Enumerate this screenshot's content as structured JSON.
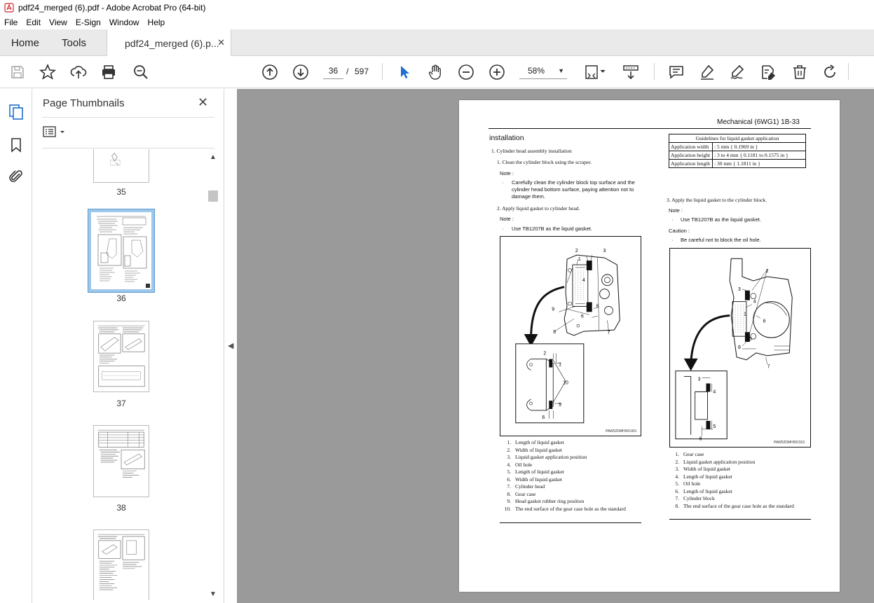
{
  "window": {
    "title": "pdf24_merged (6).pdf - Adobe Acrobat Pro (64-bit)"
  },
  "menu": [
    "File",
    "Edit",
    "View",
    "E-Sign",
    "Window",
    "Help"
  ],
  "tabs": {
    "home": "Home",
    "tools": "Tools",
    "document": "pdf24_merged (6).p...",
    "close": "✕"
  },
  "toolbar": {
    "current_page": "36",
    "page_separator": "/",
    "total_pages": "597",
    "zoom": "58%",
    "icons": [
      "save-icon",
      "bookmark-star-icon",
      "upload-icon",
      "print-icon",
      "find-zoom-icon",
      "page-up-icon",
      "page-down-icon",
      "select-cursor-icon",
      "hand-icon",
      "zoom-out-icon",
      "zoom-in-icon",
      "fit-page-icon",
      "scroll-mode-icon",
      "comment-icon",
      "highlight-icon",
      "sign-icon",
      "redact-icon",
      "delete-icon",
      "rotate-icon"
    ]
  },
  "panel": {
    "title": "Page Thumbnails",
    "close": "✕"
  },
  "thumbnails": [
    {
      "label": "35"
    },
    {
      "label": "36",
      "selected": true
    },
    {
      "label": "37"
    },
    {
      "label": "38"
    },
    {
      "label": ""
    }
  ],
  "page": {
    "header": "Mechanical (6WG1)   1B-33",
    "heading": "installation",
    "left": {
      "step1": "1.    Cylinder head assembly  installation",
      "step1_1": "1.    Clean the cylinder block using the scraper.",
      "note_label": "Note :",
      "note1_bullet": "·",
      "note1_text": "Carefully clean the cylinder block top surface and the cylinder head bottom surface, paying attention not to damage them.",
      "step1_2": "2.    Apply liquid gasket to cylinder head.",
      "note2_label": "Note :",
      "note2_text": "Use TB1207B as the liquid gasket.",
      "figure_code": "PAW52DMH001401",
      "figure_callouts": [
        "1",
        "2",
        "3",
        "4",
        "5",
        "6",
        "7",
        "8",
        "9",
        "10"
      ],
      "captions": [
        "Length of liquid gasket",
        "Width of liquid gasket",
        "Liquid gasket application position",
        "Oil hole",
        "Length of liquid gasket",
        "Width of liquid gasket",
        "Cylinder head",
        "Gear case",
        "Head gasket rubber ring position",
        "The end surface of the gear case hole as the standard"
      ]
    },
    "right": {
      "table_title": "Guidelines for liquid gasket application",
      "table_rows": [
        {
          "label": "Application width",
          "value": ":  5 mm { 0.1969 in }"
        },
        {
          "label": "Application height",
          "value": ":  3 to 4 mm { 0.1181 to 0.1575 in }"
        },
        {
          "label": "Application length",
          "value": ":  30 mm { 1.1811 in }"
        }
      ],
      "step3": "3.    Apply the liquid gasket to the cylinder block.",
      "note_label": "Note :",
      "note_text": "Use TB1207B as the liquid gasket.",
      "caution_label": "Caution :",
      "caution_text": "Be careful not to block the oil hole.",
      "figure_code": "PAW52DMH001501",
      "figure_callouts": [
        "1",
        "2",
        "3",
        "4",
        "5",
        "6",
        "7",
        "8"
      ],
      "captions": [
        "Gear case",
        "Liquid gasket application position",
        "Width of liquid gasket",
        "Length of liquid gasket",
        "Oil hole",
        "Length of liquid gasket",
        "Cylinder block",
        "The end surface of the gear case hole as the standard"
      ]
    }
  }
}
